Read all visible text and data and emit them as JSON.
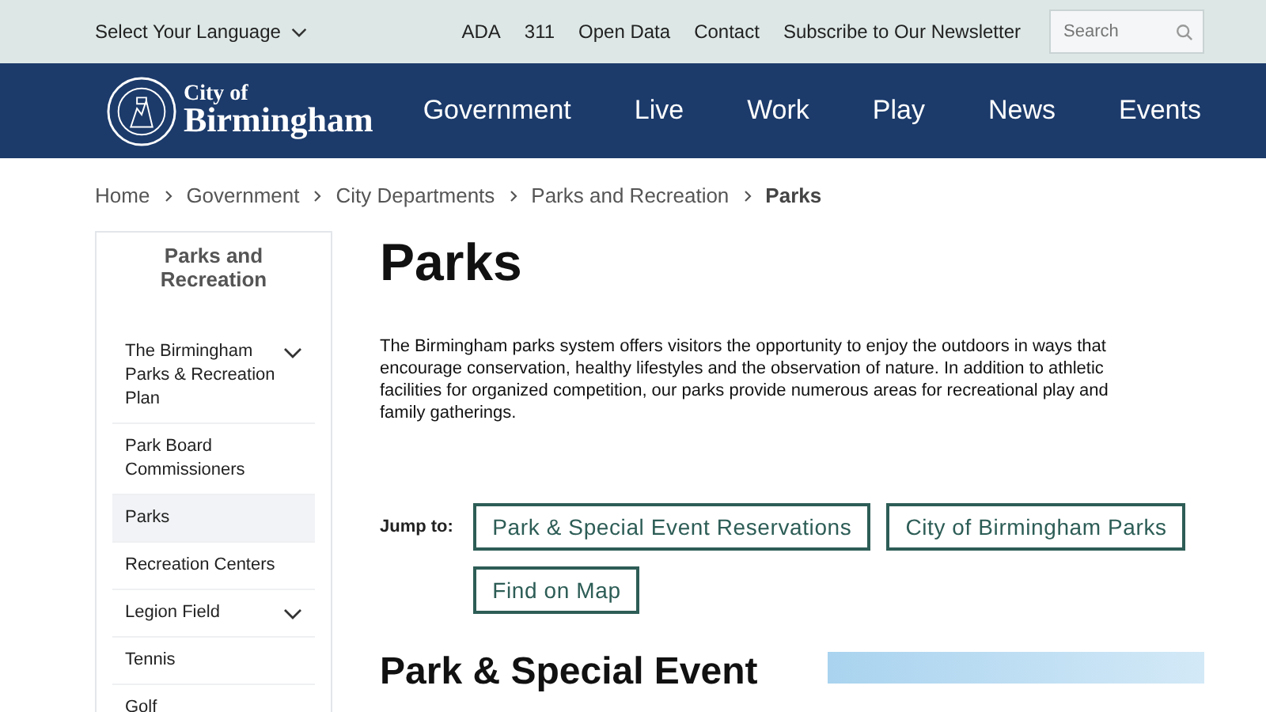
{
  "utility_bar": {
    "language": "Select Your Language",
    "links": [
      "ADA",
      "311",
      "Open Data",
      "Contact",
      "Subscribe to Our Newsletter"
    ],
    "search": {
      "placeholder": "Search"
    }
  },
  "header": {
    "logo": {
      "line_1": "City of",
      "line_2": "Birmingham"
    },
    "nav": [
      "Government",
      "Live",
      "Work",
      "Play",
      "News",
      "Events"
    ]
  },
  "breadcrumb": [
    {
      "label": "Home",
      "current": false
    },
    {
      "label": "Government",
      "current": false
    },
    {
      "label": "City Departments",
      "current": false
    },
    {
      "label": "Parks and Recreation",
      "current": false
    },
    {
      "label": "Parks",
      "current": true
    }
  ],
  "sidebar": {
    "title": "Parks and Recreation",
    "items": [
      {
        "label": "The Birmingham Parks & Recreation Plan",
        "has_children": true,
        "selected": false
      },
      {
        "label": "Park Board Commissioners",
        "has_children": false,
        "selected": false
      },
      {
        "label": "Parks",
        "has_children": false,
        "selected": true
      },
      {
        "label": "Recreation Centers",
        "has_children": false,
        "selected": false
      },
      {
        "label": "Legion Field",
        "has_children": true,
        "selected": false
      },
      {
        "label": "Tennis",
        "has_children": false,
        "selected": false
      },
      {
        "label": "Golf",
        "has_children": false,
        "selected": false
      }
    ]
  },
  "content": {
    "title": "Parks",
    "intro": "The Birmingham parks system offers visitors the opportunity to enjoy the outdoors in ways that encourage conservation, healthy lifestyles and the observation of nature. In addition to athletic facilities for organized competition, our parks provide numerous areas for recreational play and family gatherings.",
    "jump_label": "Jump to:",
    "jump_links": [
      "Park & Special Event Reservations",
      "City of Birmingham Parks",
      "Find on Map"
    ],
    "section_title": "Park & Special Event"
  }
}
